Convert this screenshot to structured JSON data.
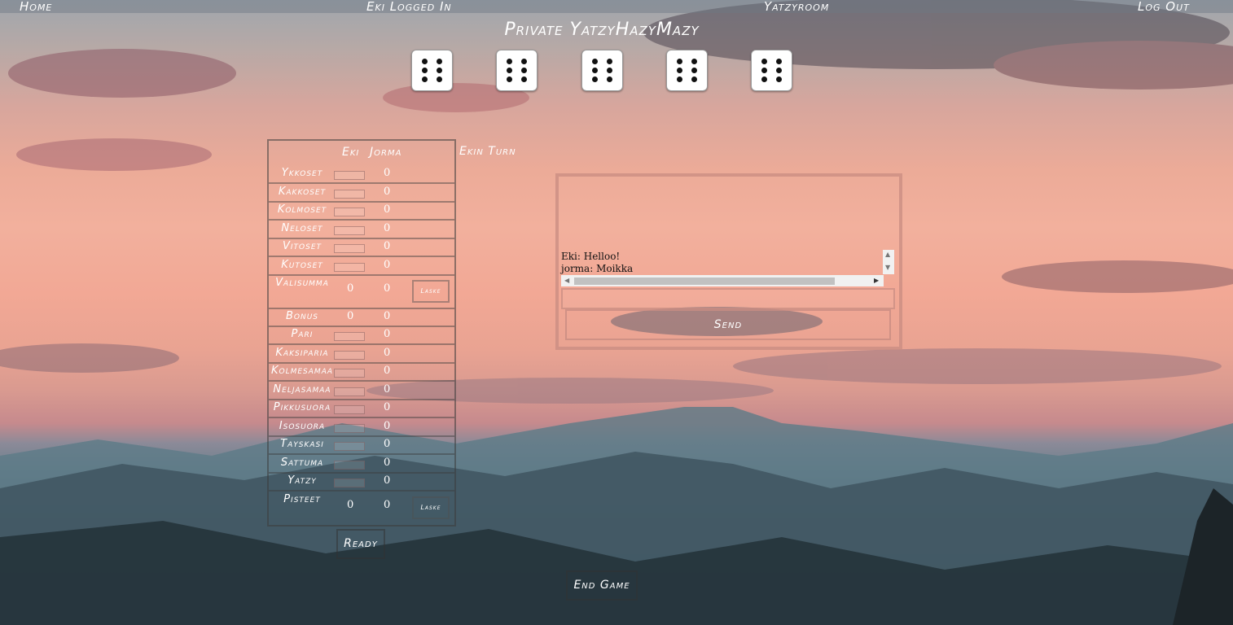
{
  "nav": {
    "home": "Home",
    "logged_in": "Eki Logged In",
    "room": "Yatzyroom",
    "logout": "Log Out"
  },
  "title": "Private YatzyHazyMazy",
  "dice": [
    6,
    6,
    6,
    6,
    6
  ],
  "score": {
    "players": [
      "Eki",
      "Jorma"
    ],
    "rows": [
      {
        "label": "Ykkoset",
        "eki": "",
        "jorma": "0"
      },
      {
        "label": "Kakkoset",
        "eki": "",
        "jorma": "0"
      },
      {
        "label": "Kolmoset",
        "eki": "",
        "jorma": "0"
      },
      {
        "label": "Neloset",
        "eki": "",
        "jorma": "0"
      },
      {
        "label": "Vitoset",
        "eki": "",
        "jorma": "0"
      },
      {
        "label": "Kutoset",
        "eki": "",
        "jorma": "0"
      },
      {
        "label": "Valisumma",
        "eki": "0",
        "jorma": "0"
      },
      {
        "label": "Bonus",
        "eki": "0",
        "jorma": "0"
      },
      {
        "label": "Pari",
        "eki": "",
        "jorma": "0"
      },
      {
        "label": "Kaksiparia",
        "eki": "",
        "jorma": "0"
      },
      {
        "label": "Kolmesamaa",
        "eki": "",
        "jorma": "0"
      },
      {
        "label": "Neljasamaa",
        "eki": "",
        "jorma": "0"
      },
      {
        "label": "Pikkusuora",
        "eki": "",
        "jorma": "0"
      },
      {
        "label": "Isosuora",
        "eki": "",
        "jorma": "0"
      },
      {
        "label": "Tayskasi",
        "eki": "",
        "jorma": "0"
      },
      {
        "label": "Sattuma",
        "eki": "",
        "jorma": "0"
      },
      {
        "label": "Yatzy",
        "eki": "",
        "jorma": "0"
      },
      {
        "label": "Pisteet",
        "eki": "0",
        "jorma": "0"
      }
    ],
    "laske_label": "Laske"
  },
  "turn_text": "Ekin Turn",
  "chat": {
    "messages": [
      "Eki: Helloo!",
      "jorma: Moikka"
    ],
    "input_value": "",
    "send_label": "Send"
  },
  "ready_label": "Ready",
  "end_game_label": "End Game"
}
